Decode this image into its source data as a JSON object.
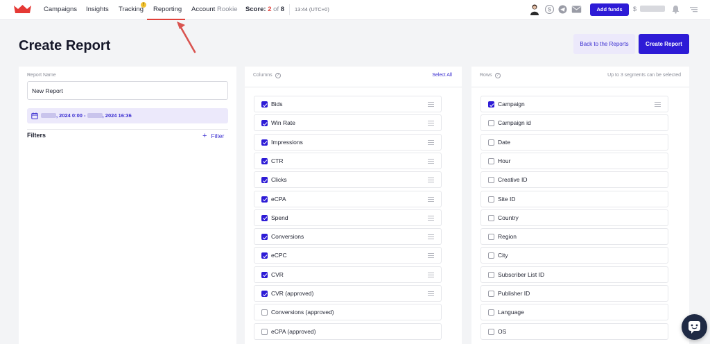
{
  "nav": {
    "items": [
      {
        "label": "Campaigns"
      },
      {
        "label": "Insights"
      },
      {
        "label": "Tracking",
        "badge": "!"
      },
      {
        "label": "Reporting",
        "active": true
      }
    ],
    "account_label": "Account",
    "account_level": "Rookie",
    "score_label": "Score:",
    "score_current": "2",
    "score_of": "of",
    "score_total": "8",
    "time": "13:44 (UTC+0)",
    "add_funds": "Add funds",
    "currency": "$",
    "icons": [
      "user-avatar",
      "skype-icon",
      "telegram-icon",
      "mail-icon",
      "bell-icon",
      "menu-icon"
    ]
  },
  "page": {
    "title": "Create Report",
    "back_button": "Back to the Reports",
    "create_button": "Create Report"
  },
  "left": {
    "report_name_label": "Report Name",
    "report_name_value": "New Report",
    "date_start_time": ", 2024 0:00 -",
    "date_end_time": ", 2024 16:36",
    "filters_title": "Filters",
    "filter_link": "Filter"
  },
  "columns": {
    "label": "Columns",
    "select_all": "Select All",
    "items": [
      {
        "name": "Bids",
        "checked": true
      },
      {
        "name": "Win Rate",
        "checked": true
      },
      {
        "name": "Impressions",
        "checked": true
      },
      {
        "name": "CTR",
        "checked": true
      },
      {
        "name": "Clicks",
        "checked": true
      },
      {
        "name": "eCPA",
        "checked": true
      },
      {
        "name": "Spend",
        "checked": true
      },
      {
        "name": "Conversions",
        "checked": true
      },
      {
        "name": "eCPC",
        "checked": true
      },
      {
        "name": "CVR",
        "checked": true
      },
      {
        "name": "CVR (approved)",
        "checked": true
      },
      {
        "name": "Conversions (approved)",
        "checked": false
      },
      {
        "name": "eCPA (approved)",
        "checked": false
      }
    ]
  },
  "rows": {
    "label": "Rows",
    "note": "Up to 3 segments can be selected",
    "items": [
      {
        "name": "Campaign",
        "checked": true
      },
      {
        "name": "Campaign id",
        "checked": false
      },
      {
        "name": "Date",
        "checked": false
      },
      {
        "name": "Hour",
        "checked": false
      },
      {
        "name": "Creative ID",
        "checked": false
      },
      {
        "name": "Site ID",
        "checked": false
      },
      {
        "name": "Country",
        "checked": false
      },
      {
        "name": "Region",
        "checked": false
      },
      {
        "name": "City",
        "checked": false
      },
      {
        "name": "Subscriber List ID",
        "checked": false
      },
      {
        "name": "Publisher ID",
        "checked": false
      },
      {
        "name": "Language",
        "checked": false
      },
      {
        "name": "OS",
        "checked": false
      }
    ]
  },
  "colors": {
    "accent": "#2d1bd6",
    "accent_light": "#ece9fb",
    "brand_red": "#e0413a",
    "badge_yellow": "#f2c230"
  }
}
